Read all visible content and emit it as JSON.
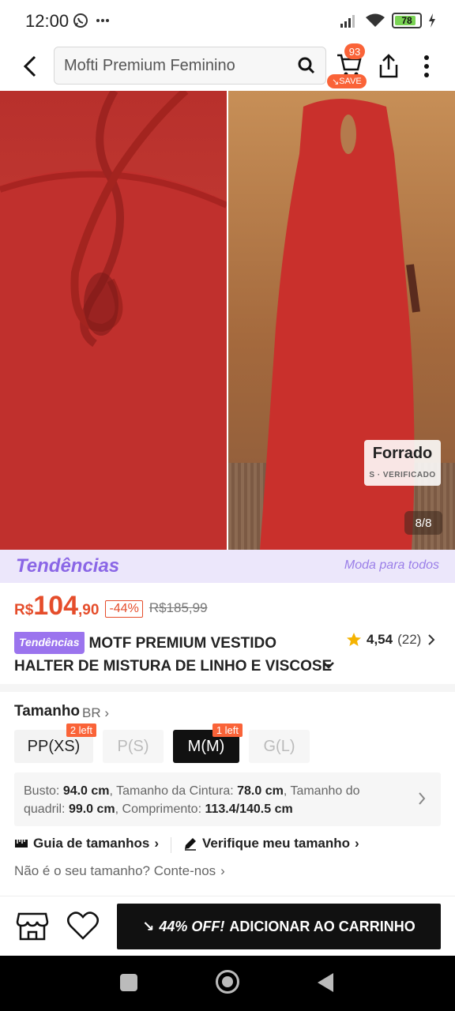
{
  "status_bar": {
    "time": "12:00",
    "battery": "78",
    "icons": [
      "whatsapp-icon",
      "more-dots-icon",
      "signal-icon",
      "wifi-icon",
      "battery-icon",
      "charging-icon"
    ]
  },
  "nav": {
    "search_text": "Mofti Premium Feminino",
    "cart_count": "93",
    "save_label": "SAVE"
  },
  "gallery": {
    "overlay_title": "Forrado",
    "overlay_sub": "S · VERIFICADO",
    "counter": "8/8"
  },
  "trend_banner": {
    "logo": "Tendências",
    "slogan": "Moda para todos"
  },
  "price": {
    "currency": "R$",
    "main": "104",
    "cents": ",90",
    "discount": "-44%",
    "original": "R$185,99"
  },
  "product": {
    "chip": "Tendências",
    "title_line1": "MOTF PREMIUM VESTIDO",
    "title_line2": "HALTER DE MISTURA DE LINHO E VISCOSE",
    "rating": "4,54",
    "review_count": "(22)"
  },
  "size": {
    "label": "Tamanho",
    "region": "BR",
    "options": [
      {
        "label": "PP(XS)",
        "tag": "2 left",
        "state": "available"
      },
      {
        "label": "P(S)",
        "tag": "",
        "state": "disabled"
      },
      {
        "label": "M(M)",
        "tag": "1 left",
        "state": "selected"
      },
      {
        "label": "G(L)",
        "tag": "",
        "state": "disabled"
      }
    ],
    "measures": {
      "bust_label": "Busto:",
      "bust_value": "94.0 cm",
      "waist_label": "Tamanho da Cintura:",
      "waist_value": "78.0 cm",
      "hip_label": "Tamanho do quadril:",
      "hip_value": "99.0 cm",
      "length_label": "Comprimento:",
      "length_value": "113.4/140.5 cm"
    },
    "guide_link": "Guia de tamanhos",
    "verify_link": "Verifique meu tamanho",
    "not_your_size": "Não é o seu tamanho? Conte-nos"
  },
  "bottom": {
    "add_off": "44% OFF!",
    "add_label": "ADICIONAR AO CARRINHO"
  },
  "colors": {
    "accent": "#e54d2b",
    "badge": "#fa6338",
    "trend_purple": "#9b74ee",
    "dress_red": "#c23a33"
  }
}
